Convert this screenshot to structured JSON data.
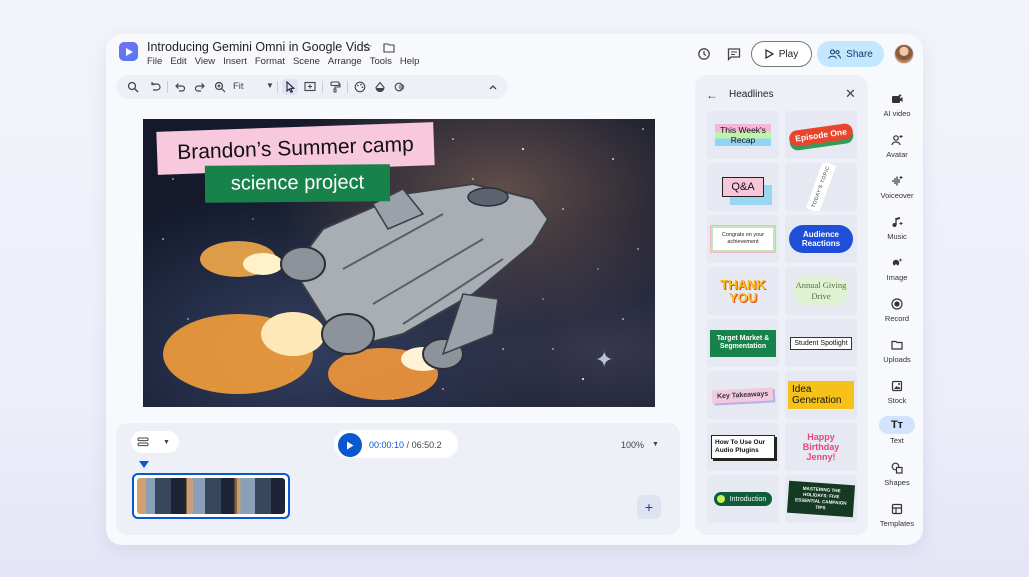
{
  "header": {
    "title": "Introducing Gemini Omni in Google Vids",
    "menu": [
      "File",
      "Edit",
      "View",
      "Insert",
      "Format",
      "Scene",
      "Arrange",
      "Tools",
      "Help"
    ],
    "play_label": "Play",
    "share_label": "Share"
  },
  "toolbar": {
    "zoom_label": "Fit"
  },
  "canvas": {
    "headline_top": "Brandon’s Summer camp",
    "headline_bottom": "science project"
  },
  "timeline": {
    "current_time": "00:00:10",
    "separator": " / ",
    "total_time": "06:50.2",
    "zoom": "100%"
  },
  "panel": {
    "title": "Headlines",
    "tiles": [
      {
        "text": "This Week's Recap"
      },
      {
        "text": "Episode One"
      },
      {
        "text": "Q&A"
      },
      {
        "text": "TODAY'S TOPIC"
      },
      {
        "text": "Congrats on your achievement"
      },
      {
        "text": "Audience Reactions"
      },
      {
        "text": "THANK YOU"
      },
      {
        "text": "Annual Giving Drive"
      },
      {
        "text": "Target Market & Segmentation"
      },
      {
        "text": "Student Spotlight"
      },
      {
        "text": "Key Takeaways"
      },
      {
        "text": "Idea Generation"
      },
      {
        "text": "How To Use Our Audio Plugins"
      },
      {
        "text": "Happy Birthday Jenny!"
      },
      {
        "text": "Introduction"
      },
      {
        "text": "MASTERING THE HOLIDAYS: FIVE ESSENTIAL CAMPAIGN TIPS"
      }
    ]
  },
  "rail": [
    {
      "label": "AI video",
      "icon": "ai-video-icon"
    },
    {
      "label": "Avatar",
      "icon": "avatar-icon"
    },
    {
      "label": "Voiceover",
      "icon": "voiceover-icon"
    },
    {
      "label": "Music",
      "icon": "music-icon"
    },
    {
      "label": "Image",
      "icon": "image-icon"
    },
    {
      "label": "Record",
      "icon": "record-icon"
    },
    {
      "label": "Uploads",
      "icon": "uploads-icon"
    },
    {
      "label": "Stock",
      "icon": "stock-icon"
    },
    {
      "label": "Text",
      "icon": "text-icon",
      "glyph": "Tт",
      "active": true
    },
    {
      "label": "Shapes",
      "icon": "shapes-icon"
    },
    {
      "label": "Templates",
      "icon": "templates-icon"
    }
  ],
  "colors": {
    "accent": "#0b57d0",
    "share_bg": "#c2e7ff",
    "headline_pink": "#f8c8dc",
    "headline_green": "#17824a"
  }
}
